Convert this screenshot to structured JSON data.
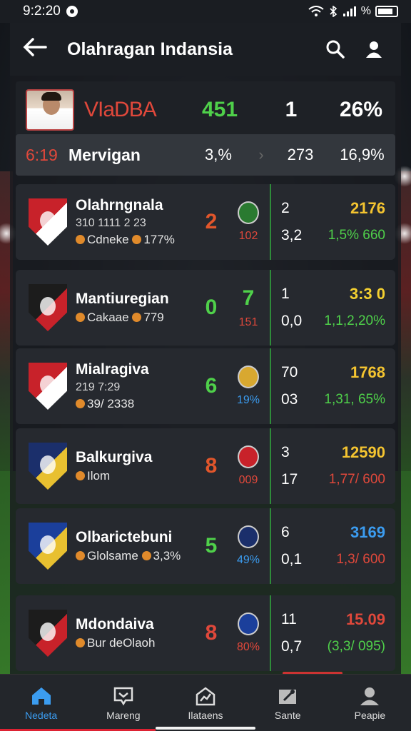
{
  "status": {
    "time": "9:2:20",
    "signal_text": "%"
  },
  "app": {
    "title": "Olahragan Indansia"
  },
  "highlight": {
    "name": "VIaDBA",
    "val1": "451",
    "val2": "1",
    "val3": "26%"
  },
  "summary": {
    "time": "6:19",
    "label": "Mervigan",
    "a": "3,%",
    "b": "273",
    "c": "16,9%"
  },
  "matches": [
    {
      "name": "Olahrngnala",
      "sub": "310 1111 2 23",
      "meta": "Cdneke",
      "meta2": "177%",
      "score": "2",
      "score_color": "#e2562b",
      "mid_val": "102",
      "mid_color": "#e0483b",
      "a": "2",
      "b": "2176",
      "b_color": "#f4c430",
      "c": "3,2",
      "d": "1,5% 660",
      "d_color": "#4fd04a",
      "crest": [
        "#c8222a",
        "#ffffff"
      ],
      "mini": "#2a7a30"
    },
    {
      "name": "Mantiuregian",
      "sub": "",
      "meta": "Cakaae",
      "meta2": "779",
      "score": "0",
      "score_color": "#4fd04a",
      "score2": "7",
      "mid_val": "151",
      "mid_color": "#e0483b",
      "a": "1",
      "b": "3:3 0",
      "b_color": "#f4d030",
      "c": "0,0",
      "d": "1,1,2,20%",
      "d_color": "#4fd04a",
      "crest": [
        "#1c1c1c",
        "#c8222a"
      ],
      "mini": ""
    },
    {
      "name": "Mialragiva",
      "sub": "219 7:29",
      "meta": "39/ 2338",
      "meta2": "",
      "score": "6",
      "score_color": "#4fd04a",
      "mid_val": "19%",
      "mid_color": "#3b9cf0",
      "a": "70",
      "b": "1768",
      "b_color": "#f4c430",
      "c": "03",
      "d": "1,31, 65%",
      "d_color": "#4fd04a",
      "crest": [
        "#c8222a",
        "#ffffff"
      ],
      "mini": "#d8a830"
    },
    {
      "name": "Balkurgiva",
      "sub": "",
      "meta": "Ilom",
      "meta2": "",
      "score": "8",
      "score_color": "#e2562b",
      "mid_val": "009",
      "mid_color": "#e0483b",
      "a": "3",
      "b": "12590",
      "b_color": "#f4c430",
      "c": "17",
      "d": "1,77/ 600",
      "d_color": "#e0483b",
      "crest": [
        "#1b2f6b",
        "#e8c030"
      ],
      "mini": "#c8222a"
    },
    {
      "name": "Olbarictebuni",
      "sub": "",
      "meta": "Glolsame",
      "meta2": "3,3%",
      "score": "5",
      "score_color": "#4fd04a",
      "mid_val": "49%",
      "mid_color": "#3b9cf0",
      "a": "6",
      "b": "3169",
      "b_color": "#3b9cf0",
      "c": "0,1",
      "d": "1,3/ 600",
      "d_color": "#e0483b",
      "crest": [
        "#1b3f9b",
        "#e8c030"
      ],
      "mini": "#1b2f6b"
    },
    {
      "name": "Mdondaiva",
      "sub": "",
      "meta": "Bur deOlaoh",
      "meta2": "",
      "score": "8",
      "score_color": "#e0483b",
      "mid_val": "80%",
      "mid_color": "#e0483b",
      "a": "11",
      "b": "15.09",
      "b_color": "#e0483b",
      "c": "0,7",
      "d": "(3,3/ 095)",
      "d_color": "#4fd04a",
      "crest": [
        "#1c1c1c",
        "#c8222a"
      ],
      "mini": "#1b3f9b"
    }
  ],
  "nav": [
    {
      "label": "Nedeta",
      "icon": "home-icon",
      "active": true
    },
    {
      "label": "Mareng",
      "icon": "chat-icon",
      "active": false
    },
    {
      "label": "Ilataens",
      "icon": "stats-icon",
      "active": false
    },
    {
      "label": "Sante",
      "icon": "map-icon",
      "active": false
    },
    {
      "label": "Peapie",
      "icon": "person-icon",
      "active": false
    }
  ]
}
